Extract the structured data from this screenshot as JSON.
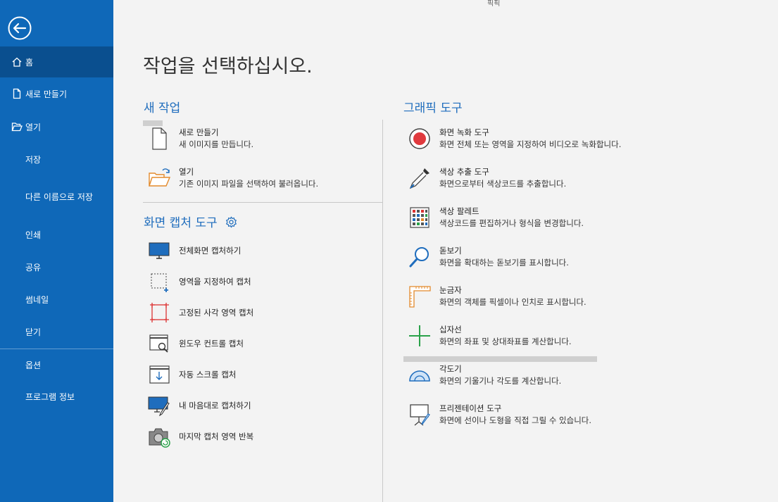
{
  "app_title": "픽픽",
  "sidebar": {
    "items": [
      {
        "label": "홈"
      },
      {
        "label": "새로 만들기"
      },
      {
        "label": "열기"
      },
      {
        "label": "저장"
      },
      {
        "label": "다른 이름으로 저장"
      },
      {
        "label": "인쇄"
      },
      {
        "label": "공유"
      },
      {
        "label": "썸네일"
      },
      {
        "label": "닫기"
      },
      {
        "label": "옵션"
      },
      {
        "label": "프로그램 정보"
      }
    ]
  },
  "main": {
    "heading": "작업을 선택하십시오.",
    "new_task": {
      "title": "새 작업",
      "items": [
        {
          "title": "새로 만들기",
          "desc": "새 이미지를 만듭니다."
        },
        {
          "title": "열기",
          "desc": "기존 이미지 파일을 선택하여 불러옵니다."
        }
      ]
    },
    "capture": {
      "title": "화면 캡처 도구",
      "items": [
        {
          "label": "전체화면 캡처하기"
        },
        {
          "label": "영역을 지정하여 캡처"
        },
        {
          "label": "고정된 사각 영역 캡처"
        },
        {
          "label": "윈도우 컨트롤 캡처"
        },
        {
          "label": "자동 스크롤 캡처"
        },
        {
          "label": "내 마음대로 캡처하기"
        },
        {
          "label": "마지막 캡처 영역 반복"
        }
      ]
    },
    "graphics": {
      "title": "그래픽 도구",
      "items": [
        {
          "title": "화면 녹화 도구",
          "desc": "화면 전체 또는 영역을 지정하여 비디오로 녹화합니다."
        },
        {
          "title": "색상 추출 도구",
          "desc": "화면으로부터 색상코드를 추출합니다."
        },
        {
          "title": "색상 팔레트",
          "desc": "색상코드를 편집하거나 형식을 변경합니다."
        },
        {
          "title": "돋보기",
          "desc": "화면을 확대하는 돋보기를 표시합니다."
        },
        {
          "title": "눈금자",
          "desc": "화면의 객체를 픽셀이나 인치로 표시합니다."
        },
        {
          "title": "십자선",
          "desc": "화면의 좌표 및 상대좌표를 계산합니다."
        },
        {
          "title": "각도기",
          "desc": "화면의 기울기나 각도를 계산합니다."
        },
        {
          "title": "프리젠테이션 도구",
          "desc": "화면에 선이나 도형을 직접 그릴 수 있습니다."
        }
      ]
    }
  },
  "colors": {
    "sidebar_bg": "#0f68b8",
    "sidebar_active": "#0a4f8f",
    "accent": "#1f6dbd",
    "record_red": "#e03a3e"
  }
}
